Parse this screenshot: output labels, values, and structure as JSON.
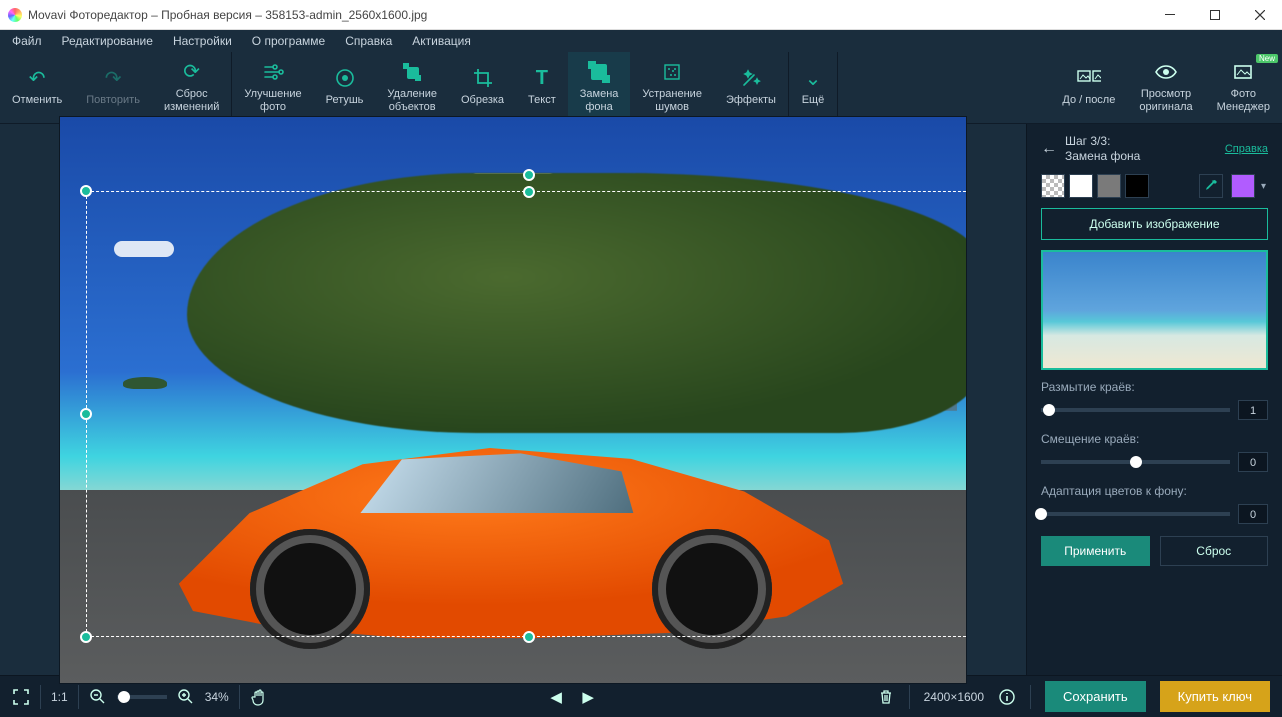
{
  "titlebar": {
    "text": "Movavi Фоторедактор – Пробная версия – 358153-admin_2560x1600.jpg"
  },
  "menu": {
    "file": "Файл",
    "edit": "Редактирование",
    "settings": "Настройки",
    "about": "О программе",
    "help": "Справка",
    "activation": "Активация"
  },
  "toolbar": {
    "undo": "Отменить",
    "redo": "Повторить",
    "reset": "Сброс\nизменений",
    "enhance": "Улучшение\nфото",
    "retouch": "Ретушь",
    "remove": "Удаление\nобъектов",
    "crop": "Обрезка",
    "text": "Текст",
    "bgreplace": "Замена\nфона",
    "denoise": "Устранение\nшумов",
    "effects": "Эффекты",
    "more": "Ещё",
    "before_after": "До / после",
    "view_original": "Просмотр\nоригинала",
    "photo_manager": "Фото\nМенеджер",
    "new_badge": "New"
  },
  "panel": {
    "step": "Шаг 3/3:",
    "title": "Замена фона",
    "help": "Справка",
    "add_image": "Добавить изображение",
    "blur_label": "Размытие краёв:",
    "blur_value": "1",
    "shift_label": "Смещение краёв:",
    "shift_value": "0",
    "adapt_label": "Адаптация цветов к фону:",
    "adapt_value": "0",
    "apply": "Применить",
    "reset": "Сброс",
    "colors": {
      "white": "#ffffff",
      "gray": "#7a7a7a",
      "black": "#000000",
      "accent": "#b15cff"
    }
  },
  "footer": {
    "ratio": "1:1",
    "zoom": "34%",
    "dimensions": "2400×1600",
    "save": "Сохранить",
    "buy": "Купить ключ"
  }
}
